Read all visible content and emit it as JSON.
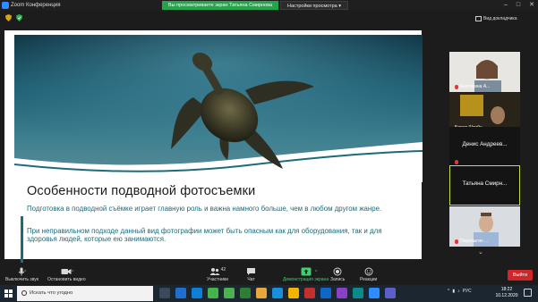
{
  "window": {
    "title": "Zoom Конференция",
    "controls": [
      "–",
      "□",
      "✕"
    ]
  },
  "share_banner": {
    "status": "Вы просматриваете экран Татьяна Смирнова",
    "view_options": "Настройки просмотра ▾"
  },
  "top": {
    "gallery_view": "Вид докладчика"
  },
  "slide": {
    "title": "Особенности подводной фотосъемки",
    "paragraph1": "Подготовка в подводной съёмке играет главную роль и важна намного больше, чем в любом другом жанре.",
    "paragraph2": "При неправильном подходе данный вид фотографии может быть опасным как для оборудования, так и для здоровья людей, которые ею занимаются."
  },
  "participants": [
    {
      "name": "Екатерина А...",
      "muted": true
    },
    {
      "name": "Борис Штейн",
      "muted": false
    },
    {
      "name": "Денис Андреев...",
      "muted": true
    },
    {
      "name": "Татьяна Смирн...",
      "muted": false
    },
    {
      "name": "Перелыгин ...",
      "muted": true
    }
  ],
  "toolbar": {
    "mute": "Выключить звук",
    "video": "Остановить видео",
    "participants": "Участники",
    "participants_count": "42",
    "chat": "Чат",
    "share": "Демонстрация экрана",
    "record": "Запись",
    "reactions": "Реакции",
    "leave": "Выйти"
  },
  "taskbar": {
    "search_placeholder": "Искать что угодно",
    "language": "РУС",
    "time": "18:22",
    "date": "10.12.2020"
  },
  "colors": {
    "share_green": "#23a54b",
    "leave_red": "#d0262a",
    "slide_teal": "#1d6b7a",
    "active_speaker": "#bfe04a"
  }
}
